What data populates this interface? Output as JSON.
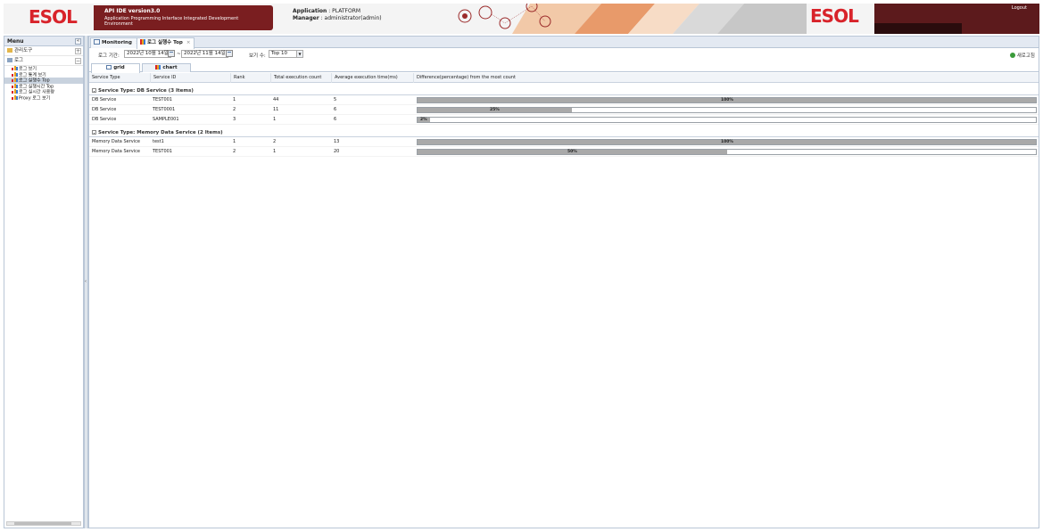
{
  "header": {
    "logo_left": "ESOL",
    "logo_right": "ESOL",
    "title": "API IDE  version3.0",
    "subtitle": "Application Programming Interface Integrated Development Environment",
    "application_label": "Application",
    "application_value": ": PLATFORM",
    "manager_label": "Manager",
    "manager_value": ": administrator(admin)",
    "logout": "Logout",
    "colors": {
      "brand_red": "#d8232a",
      "title_box": "#7a1e20",
      "right_box": "#5c1a1c"
    }
  },
  "menu": {
    "title": "Menu",
    "collapse_icon": "«",
    "groups": [
      {
        "label": "관리도구",
        "toggle": "+"
      },
      {
        "label": "로그",
        "toggle": "−"
      }
    ],
    "items": [
      {
        "label": "로그 보기"
      },
      {
        "label": "로그 통계 보기"
      },
      {
        "label": "로그 실행수 Top"
      },
      {
        "label": "로그 실행시간 Top"
      },
      {
        "label": "로그 실시간 사용량"
      },
      {
        "label": "Proxy 로그 보기"
      }
    ],
    "selected_index": 2,
    "splitter_arrow": "‹"
  },
  "tabs": [
    {
      "label": "Monitoring",
      "close": "×"
    },
    {
      "label": "로그 실행수 Top",
      "close": "×"
    }
  ],
  "filter": {
    "period_label": "로그 기간:",
    "date_from": "2022년 10월 14일",
    "separator": "~",
    "date_to": "2022년 11월 14일",
    "count_label": "보기 수:",
    "count_value": "Top 10",
    "count_arrow": "▼",
    "refresh": "새로고침"
  },
  "subtabs": [
    {
      "label": "grid"
    },
    {
      "label": "chart"
    }
  ],
  "grid": {
    "columns": [
      "Service Type",
      "Service ID",
      "Rank",
      "Total execution count",
      "Average execution time(ms)",
      "Difference(percentage) from the most count"
    ],
    "groups": [
      {
        "header": "Service Type: DB Service (3 Items)",
        "rows": [
          {
            "type": "DB Service",
            "id": "TEST001",
            "rank": "1",
            "count": "44",
            "avg": "5",
            "pct": 100,
            "pct_label": "100%"
          },
          {
            "type": "DB Service",
            "id": "TEST0001",
            "rank": "2",
            "count": "11",
            "avg": "6",
            "pct": 25,
            "pct_label": "25%"
          },
          {
            "type": "DB Service",
            "id": "SAMPLE001",
            "rank": "3",
            "count": "1",
            "avg": "6",
            "pct": 2,
            "pct_label": "2%"
          }
        ]
      },
      {
        "header": "Service Type: Memory Data Service (2 Items)",
        "rows": [
          {
            "type": "Memory Data Service",
            "id": "test1",
            "rank": "1",
            "count": "2",
            "avg": "13",
            "pct": 100,
            "pct_label": "100%"
          },
          {
            "type": "Memory Data Service",
            "id": "TEST001",
            "rank": "2",
            "count": "1",
            "avg": "20",
            "pct": 50,
            "pct_label": "50%"
          }
        ]
      }
    ]
  }
}
